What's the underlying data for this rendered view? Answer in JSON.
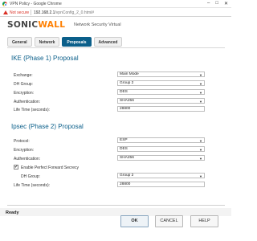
{
  "window": {
    "title": "VPN Policy - Google Chrome",
    "minimize": "–",
    "maximize": "□",
    "close": "✕"
  },
  "address_bar": {
    "security": "Not secure",
    "url_host": "192.168.2.1",
    "url_path": "/vpnConfig_2_0.html#"
  },
  "brand": {
    "logo_part1": "SONIC",
    "logo_part2": "WALL",
    "subtitle": "Network Security Virtual"
  },
  "tabs": [
    {
      "label": "General"
    },
    {
      "label": "Network"
    },
    {
      "label": "Proposals"
    },
    {
      "label": "Advanced"
    }
  ],
  "ike": {
    "title": "IKE (Phase 1) Proposal",
    "exchange": {
      "label": "Exchange:",
      "value": "Main Mode"
    },
    "dh_group": {
      "label": "DH Group:",
      "value": "Group 2"
    },
    "encryption": {
      "label": "Encryption:",
      "value": "DES"
    },
    "authentication": {
      "label": "Authentication:",
      "value": "SHA256"
    },
    "lifetime": {
      "label": "Life Time (seconds):",
      "value": "28800"
    }
  },
  "ipsec": {
    "title": "Ipsec (Phase 2) Proposal",
    "protocol": {
      "label": "Protocol:",
      "value": "ESP"
    },
    "encryption": {
      "label": "Encryption:",
      "value": "DES"
    },
    "authentication": {
      "label": "Authentication:",
      "value": "SHA256"
    },
    "pfs": {
      "label": "Enable Perfect Forward Secrecy",
      "checked": true,
      "mark": "✔"
    },
    "dh_group": {
      "label": "DH Group:",
      "value": "Group 2"
    },
    "lifetime": {
      "label": "Life Time (seconds):",
      "value": "28800"
    }
  },
  "status": "Ready",
  "buttons": {
    "ok": "OK",
    "cancel": "CANCEL",
    "help": "HELP"
  },
  "icons": {
    "dropdown": "▼"
  },
  "colors": {
    "accent": "#0b5f8a",
    "brand_orange": "#ff7f00",
    "warning": "#d93025"
  }
}
